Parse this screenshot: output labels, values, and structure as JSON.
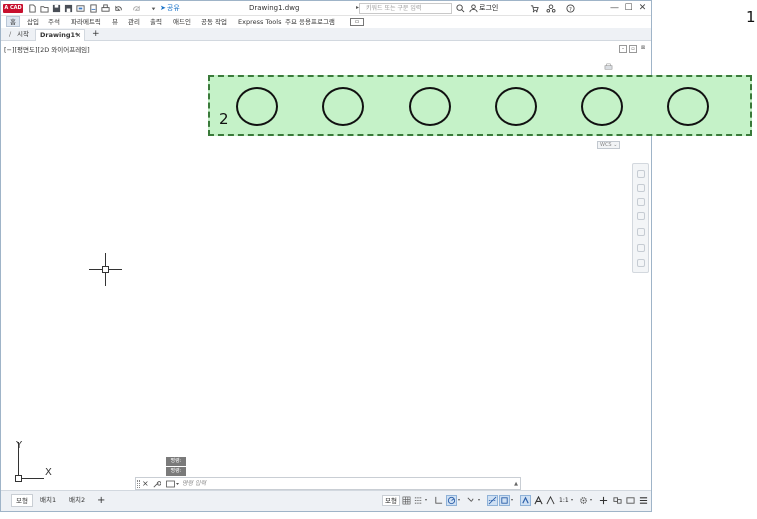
{
  "app": {
    "logo_text": "A CAD",
    "document_title": "Drawing1.dwg",
    "share_label": "공유",
    "search_placeholder": "키워드 또는 구문 입력",
    "login_label": "로그인",
    "window_controls": [
      "—",
      "☐",
      "✕"
    ]
  },
  "ribbon": {
    "tabs": [
      "홈",
      "삽입",
      "주석",
      "파라메트릭",
      "뷰",
      "관리",
      "출력",
      "애드인",
      "공동 작업",
      "Express Tools",
      "주요 응용프로그램"
    ],
    "active_tab": "홈"
  },
  "file_tabs": {
    "start_label": "시작",
    "drawing_label": "Drawing1*",
    "close_glyph": "×",
    "add_glyph": "+"
  },
  "viewport": {
    "view_label": "[−][평면도][2D 와이어프레임]",
    "wcs_label": "WCS",
    "ucs_x": "X",
    "ucs_y": "Y"
  },
  "annotations": {
    "label_1": "1",
    "label_2": "2",
    "highlight_color": "#c5f2c8",
    "circle_count": 6
  },
  "command": {
    "history": [
      "명령:",
      "명령:"
    ],
    "input_placeholder": "명령 입력",
    "close_glyph": "×"
  },
  "status": {
    "layout_tabs": [
      "모형",
      "배치1",
      "배치2"
    ],
    "active_layout": "모형",
    "add_layout": "+",
    "model_space": "모형",
    "scale": "1:1"
  },
  "icons": [
    "new-icon",
    "open-icon",
    "save-icon",
    "saveas-icon",
    "plot-icon",
    "print-icon",
    "undo-icon",
    "redo-icon",
    "search-icon",
    "user-icon",
    "cart-icon",
    "share-icon",
    "help-icon",
    "grid-icon",
    "snap-icon",
    "ortho-icon",
    "polar-icon",
    "osnap-icon",
    "settings-icon",
    "menu-icon"
  ]
}
